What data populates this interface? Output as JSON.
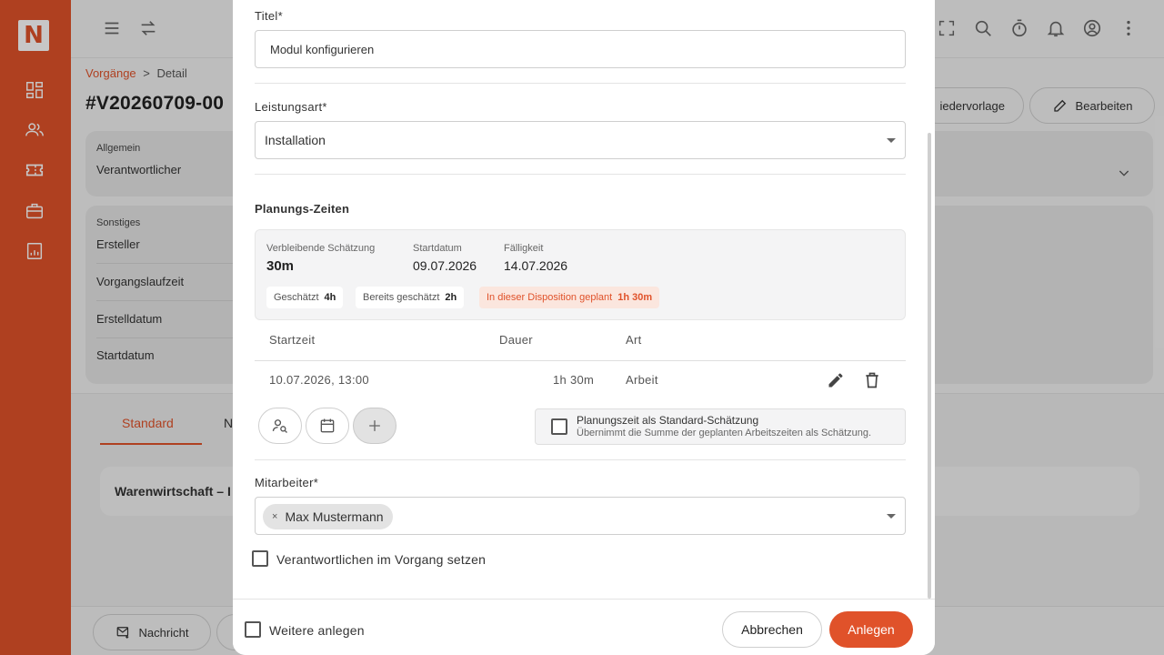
{
  "colors": {
    "accent": "#e0522a",
    "rail": "#e0522a"
  },
  "logo": {
    "text": "N"
  },
  "rail": {
    "items": [
      "dashboard-icon",
      "users-icon",
      "ticket-icon",
      "briefcase-icon",
      "report-icon"
    ]
  },
  "topbar": {
    "icons": [
      "menu-icon",
      "swap-icon",
      "fullscreen-icon",
      "search-icon",
      "timer-icon",
      "bell-icon",
      "account-icon",
      "more-icon"
    ]
  },
  "page": {
    "breadcrumb": {
      "parent": "Vorgänge",
      "separator": ">",
      "current": "Detail"
    },
    "title": "#V20260709-00",
    "buttons": {
      "template": "iedervorlage",
      "edit": "Bearbeiten"
    },
    "general_card": {
      "section": "Allgemein",
      "row": "Verantwortlicher"
    },
    "other_card": {
      "section": "Sonstiges",
      "rows": [
        "Ersteller",
        "Vorgangslaufzeit",
        "Erstelldatum",
        "Startdatum"
      ]
    },
    "tabs": {
      "active": "Standard",
      "next": "N"
    },
    "warehouse_row": "Warenwirtschaft – I",
    "bottom": {
      "message_button": "Nachricht"
    }
  },
  "modal": {
    "title_field": {
      "label": "Titel*",
      "value": "Modul konfigurieren"
    },
    "service_field": {
      "label": "Leistungsart*",
      "value": "Installation"
    },
    "planning": {
      "heading": "Planungs-Zeiten",
      "remaining_label": "Verbleibende Schätzung",
      "remaining_value": "30m",
      "start_label": "Startdatum",
      "start_value": "09.07.2026",
      "due_label": "Fälligkeit",
      "due_value": "14.07.2026",
      "chips": [
        {
          "label": "Geschätzt",
          "value": "4h"
        },
        {
          "label": "Bereits geschätzt",
          "value": "2h"
        },
        {
          "label": "In dieser Disposition geplant",
          "value": "1h 30m"
        }
      ],
      "columns": {
        "start": "Startzeit",
        "duration": "Dauer",
        "type": "Art"
      },
      "rows": [
        {
          "start": "10.07.2026, 13:00",
          "duration": "1h 30m",
          "type": "Arbeit"
        }
      ],
      "standard_estimate": {
        "title": "Planungszeit als Standard-Schätzung",
        "subtitle": "Übernimmt die Summe der geplanten Arbeitszeiten als Schätzung.",
        "checked": false
      }
    },
    "employee_field": {
      "label": "Mitarbeiter*",
      "selected": "Max Mustermann",
      "remove": "×"
    },
    "set_responsible": {
      "label": "Verantwortlichen im Vorgang setzen",
      "checked": false
    },
    "footer": {
      "more_label": "Weitere anlegen",
      "cancel": "Abbrechen",
      "create": "Anlegen"
    }
  }
}
